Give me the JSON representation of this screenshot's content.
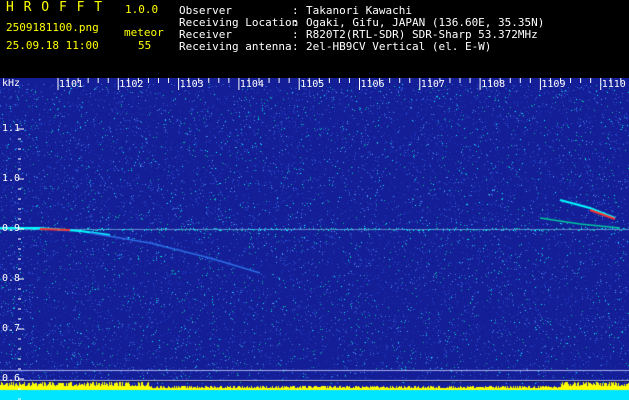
{
  "header": {
    "app_name": "H R O F F T",
    "version": "1.0.0",
    "filename": "2509181100.png",
    "datetime": "25.09.18 11:00",
    "meteor_label": "meteor",
    "meteor_count": "55",
    "fields": [
      {
        "label": "Observer",
        "value": "Takanori Kawachi"
      },
      {
        "label": "Receiving Location",
        "value": "Ogaki, Gifu, JAPAN (136.60E, 35.35N)"
      },
      {
        "label": "Receiver",
        "value": "R820T2(RTL-SDR) SDR-Sharp 53.372MHz"
      },
      {
        "label": "Receiving antenna",
        "value": "2el-HB9CV Vertical (el. E-W)"
      }
    ]
  },
  "plot": {
    "y_unit": "kHz",
    "y_ticks": [
      "1.1",
      "1.0",
      "0.9",
      "0.8",
      "0.7",
      "0.6"
    ],
    "x_ticks": [
      "1101",
      "1102",
      "1103",
      "1104",
      "1105",
      "1106",
      "1107",
      "1108",
      "1109",
      "1110"
    ],
    "colors": {
      "background": "#141e96",
      "noise_high": "#00ffff",
      "noise_mid": "#00c8a0",
      "baseline_yellow": "#ffff00",
      "baseline_cyan": "#00e5ff",
      "echo_red": "#ff3030"
    }
  }
}
